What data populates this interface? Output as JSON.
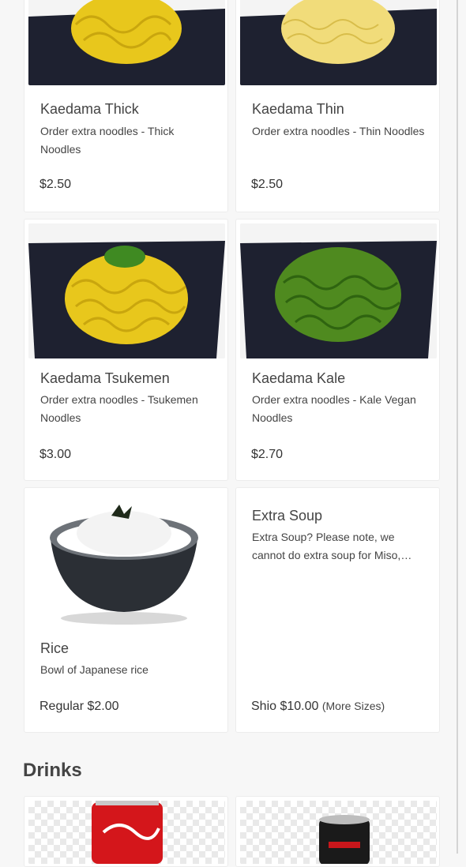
{
  "menu_items": [
    {
      "title": "Kaedama Thick",
      "description": "Order extra noodles - Thick Noodles",
      "price": "$2.50"
    },
    {
      "title": "Kaedama Thin",
      "description": "Order extra noodles - Thin Noodles",
      "price": "$2.50"
    },
    {
      "title": "Kaedama Tsukemen",
      "description": "Order extra noodles - Tsukemen Noodles",
      "price": "$3.00"
    },
    {
      "title": "Kaedama Kale",
      "description": "Order extra noodles - Kale Vegan Noodles",
      "price": "$2.70"
    },
    {
      "title": "Rice",
      "description": "Bowl of Japanese rice",
      "price": "Regular $2.00"
    },
    {
      "title": "Extra Soup",
      "description": "Extra Soup? Please note, we cannot do extra soup for Miso,…",
      "price": "Shio $10.00",
      "more": "(More Sizes)"
    }
  ],
  "sections": {
    "drinks": "Drinks"
  },
  "colors": {
    "noodle_yellow": "#e8c71c",
    "kale_green": "#4f8a1f",
    "plate_black": "#1e2130",
    "can_red": "#d4161b"
  }
}
